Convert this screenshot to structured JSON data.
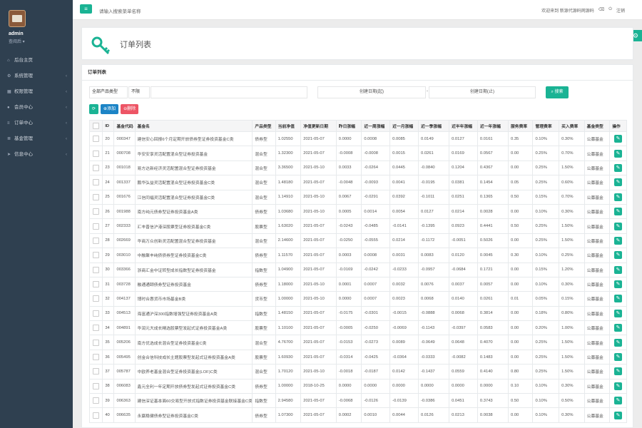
{
  "sidebar": {
    "username": "admin",
    "role": "查阅后 ▾",
    "items": [
      {
        "label": "后台主页",
        "icon": "home-icon",
        "glyph": "⌂",
        "arrow": false
      },
      {
        "label": "系统管理",
        "icon": "gear-icon",
        "glyph": "⚙",
        "arrow": true
      },
      {
        "label": "权限管理",
        "icon": "table-icon",
        "glyph": "▦",
        "arrow": true
      },
      {
        "label": "会员中心",
        "icon": "user-icon",
        "glyph": "●",
        "arrow": true
      },
      {
        "label": "订单中心",
        "icon": "list-icon",
        "glyph": "≡",
        "arrow": true
      },
      {
        "label": "基金管理",
        "icon": "menu-icon",
        "glyph": "≣",
        "arrow": true
      },
      {
        "label": "信息中心",
        "icon": "send-icon",
        "glyph": "➤",
        "arrow": true
      }
    ]
  },
  "topbar": {
    "search_placeholder": "请输入搜索菜单名称",
    "welcome": "欢迎来到 新源代源码网源码",
    "logout": "注销"
  },
  "header": {
    "title": "订单列表"
  },
  "panel": {
    "title": "订单列表"
  },
  "filters": {
    "product_type": "全部产品类型",
    "status": "不限",
    "date_start": "创建日期(起)",
    "date_end": "创建日期(止)",
    "search_label": "搜索"
  },
  "toolbar": {
    "refresh": "⟳",
    "add": "添加",
    "delete": "删除"
  },
  "colors": {
    "accent": "#1ab394",
    "primary": "#1c84c6",
    "danger": "#ed5565",
    "sidebar": "#2f4050"
  },
  "table": {
    "headers": [
      "ID",
      "基金代码",
      "基金名",
      "产品类型",
      "当前净值",
      "净值更新日期",
      "昨日涨幅",
      "近一周涨幅",
      "近一月涨幅",
      "近一季涨幅",
      "近半年涨幅",
      "近一年涨幅",
      "服务费率",
      "管理费率",
      "买入费率",
      "基金类型",
      "操作"
    ],
    "rows": [
      [
        "20",
        "000347",
        "建信安心回报6个月定期开放债券型证券投资基金C类",
        "债券型",
        "1.02550",
        "2021-05-07",
        "0.0000",
        "0.0008",
        "0.0085",
        "0.0149",
        "0.0127",
        "0.0161",
        "0.35",
        "0.10%",
        "0.30%",
        "公募基金"
      ],
      [
        "21",
        "000708",
        "华安安享灵活配置混合型证券投资基金",
        "混合型",
        "1.32300",
        "2021-05-07",
        "-0.0008",
        "-0.0008",
        "0.0015",
        "0.0261",
        "0.0169",
        "0.0567",
        "0.00",
        "0.25%",
        "0.70%",
        "公募基金"
      ],
      [
        "23",
        "001018",
        "易方达新经济灵活配置混合型证券投资基金",
        "混合型",
        "3.36500",
        "2021-05-10",
        "0.0033",
        "-0.0264",
        "0.0445",
        "-0.0840",
        "0.1204",
        "0.4367",
        "0.00",
        "0.25%",
        "1.50%",
        "公募基金"
      ],
      [
        "24",
        "001337",
        "鹏华弘益灵活配置混合型证券投资基金C类",
        "混合型",
        "1.48180",
        "2021-05-07",
        "-0.0048",
        "-0.0093",
        "0.0041",
        "-0.0195",
        "0.0381",
        "0.1454",
        "0.05",
        "0.25%",
        "0.60%",
        "公募基金"
      ],
      [
        "25",
        "001676",
        "江信同福灵活配置混合型证券投资基金C类",
        "混合型",
        "1.14910",
        "2021-05-10",
        "0.0067",
        "-0.0291",
        "0.0392",
        "-0.1011",
        "0.0251",
        "0.1365",
        "0.50",
        "0.15%",
        "0.70%",
        "公募基金"
      ],
      [
        "26",
        "001988",
        "南方纯元债券型证券投资基金A类",
        "债券型",
        "1.03680",
        "2021-05-10",
        "0.0005",
        "0.0014",
        "0.0054",
        "0.0127",
        "0.0214",
        "0.0028",
        "0.00",
        "0.10%",
        "0.30%",
        "公募基金"
      ],
      [
        "27",
        "002333",
        "汇丰晋信沪港深股票型证券投资基金C类",
        "股票型",
        "1.63020",
        "2021-05-07",
        "-0.0243",
        "-0.0485",
        "-0.0141",
        "-0.1395",
        "0.0923",
        "0.4441",
        "0.50",
        "0.25%",
        "1.50%",
        "公募基金"
      ],
      [
        "28",
        "002669",
        "华商万众创新灵活配置混合型证券投资基金",
        "混合型",
        "2.14600",
        "2021-05-07",
        "-0.0250",
        "-0.0555",
        "0.0214",
        "-0.1172",
        "-0.0051",
        "0.5026",
        "0.00",
        "0.25%",
        "1.50%",
        "公募基金"
      ],
      [
        "29",
        "003010",
        "中融聚丰纯债债券型证券投资基金C类",
        "债券型",
        "1.11570",
        "2021-05-07",
        "0.0003",
        "0.0008",
        "0.0031",
        "0.0083",
        "0.0120",
        "0.0045",
        "0.30",
        "0.10%",
        "0.25%",
        "公募基金"
      ],
      [
        "30",
        "003366",
        "浙商汇金中证转型成长指数型证券投资基金",
        "指数型",
        "1.04900",
        "2021-05-07",
        "-0.0169",
        "-0.0242",
        "-0.0233",
        "-0.0957",
        "-0.0684",
        "0.1721",
        "0.00",
        "0.15%",
        "1.20%",
        "公募基金"
      ],
      [
        "31",
        "003728",
        "融通通颐债券型证券投资基金",
        "债券型",
        "1.18000",
        "2021-05-10",
        "0.0001",
        "0.0007",
        "0.0032",
        "0.0076",
        "0.0037",
        "0.0057",
        "0.00",
        "0.10%",
        "0.30%",
        "公募基金"
      ],
      [
        "32",
        "004137",
        "博时合惠货币市场基金B类",
        "货币型",
        "1.00000",
        "2021-05-10",
        "0.0000",
        "0.0007",
        "0.0023",
        "0.0068",
        "0.0140",
        "0.0261",
        "0.01",
        "0.05%",
        "0.15%",
        "公募基金"
      ],
      [
        "33",
        "004513",
        "海富通沪深300指数增强型证券投资基金A类",
        "指数型",
        "1.48150",
        "2021-05-07",
        "-0.0175",
        "-0.0301",
        "-0.0015",
        "-0.0888",
        "0.0068",
        "0.3814",
        "0.00",
        "0.18%",
        "0.80%",
        "公募基金"
      ],
      [
        "34",
        "004891",
        "华润元大成长精选股票型发起式证券投资基金A类",
        "股票型",
        "1.10100",
        "2021-05-07",
        "-0.0005",
        "-0.0250",
        "-0.0069",
        "-0.1143",
        "-0.0397",
        "0.0583",
        "0.00",
        "0.20%",
        "1.00%",
        "公募基金"
      ],
      [
        "35",
        "005206",
        "南方优选成长混合型证券投资基金C类",
        "混合型",
        "4.76700",
        "2021-05-07",
        "-0.0153",
        "-0.0273",
        "0.0089",
        "-0.0649",
        "0.0648",
        "0.4070",
        "0.00",
        "0.25%",
        "1.50%",
        "公募基金"
      ],
      [
        "36",
        "005495",
        "创金合信科技成长主题股票型发起式证券投资基金A类",
        "股票型",
        "1.60930",
        "2021-05-07",
        "-0.0314",
        "-0.0425",
        "-0.0364",
        "-0.0333",
        "-0.0082",
        "0.1483",
        "0.00",
        "0.25%",
        "1.50%",
        "公募基金"
      ],
      [
        "37",
        "005787",
        "中欧养老基金混合型证券投资基金(LOF)C类",
        "混合型",
        "1.70120",
        "2021-05-10",
        "-0.0018",
        "-0.0187",
        "0.0142",
        "-0.1437",
        "0.0559",
        "0.4140",
        "0.80",
        "0.25%",
        "1.50%",
        "公募基金"
      ],
      [
        "38",
        "006083",
        "鑫元全利一年定期开放债券型发起式证券投资基金C类",
        "债券型",
        "1.00000",
        "2018-10-25",
        "0.0000",
        "0.0000",
        "0.0000",
        "0.0000",
        "0.0000",
        "0.0000",
        "0.10",
        "0.10%",
        "0.30%",
        "公募基金"
      ],
      [
        "39",
        "006363",
        "建信深证基本面60交易型开放式指数证券投资基金联接基金C类",
        "指数型",
        "2.94580",
        "2021-05-07",
        "-0.0068",
        "-0.0126",
        "-0.0139",
        "-0.0386",
        "0.0451",
        "0.3743",
        "0.50",
        "0.10%",
        "0.50%",
        "公募基金"
      ],
      [
        "40",
        "006635",
        "永赢稳健债券型证券投资基金C类",
        "债券型",
        "1.07300",
        "2021-05-07",
        "0.0002",
        "0.0010",
        "0.0044",
        "0.0126",
        "0.0213",
        "0.0038",
        "0.00",
        "0.10%",
        "0.30%",
        "公募基金"
      ]
    ]
  }
}
